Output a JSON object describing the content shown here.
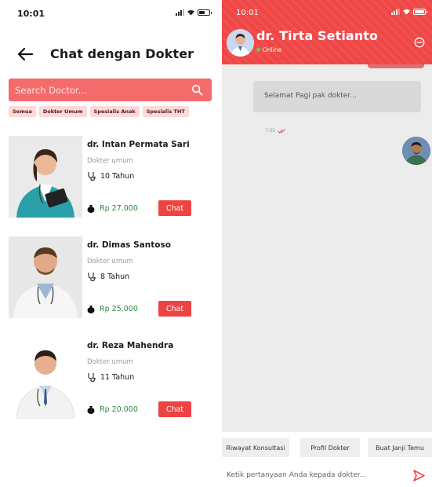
{
  "left": {
    "status": {
      "time": "10:01"
    },
    "title": "Chat dengan Dokter",
    "search": {
      "placeholder": "Search Doctor..."
    },
    "filters": [
      "Semua",
      "Dokter Umum",
      "Spesialis Anak",
      "Spesialis THT"
    ],
    "doctors": [
      {
        "name": "dr. Intan Permata Sari",
        "specialty": "Dokter umum",
        "experience": "10 Tahun",
        "price": "Rp 27.000",
        "chat_label": "Chat"
      },
      {
        "name": "dr. Dimas Santoso",
        "specialty": "Dokter umum",
        "experience": "8 Tahun",
        "price": "Rp 25.000",
        "chat_label": "Chat"
      },
      {
        "name": "dr. Reza Mahendra",
        "specialty": "Dokter umum",
        "experience": "11 Tahun",
        "price": "Rp 20.000",
        "chat_label": "Chat"
      }
    ]
  },
  "right": {
    "status": {
      "time": "10:01"
    },
    "doctor_name": "dr. Tirta Setianto",
    "status_text": "Online",
    "message": {
      "text": "Selamat Pagi pak dokter...",
      "time": "7:01"
    },
    "quick_actions": [
      "Riwayat Konsultasi",
      "Profil Dokter",
      "Buat Janji Temu"
    ],
    "input": {
      "placeholder": "Ketik pertanyaan Anda kepada dokter..."
    }
  },
  "colors": {
    "accent": "#ef4646",
    "search_bg": "#f36b6b",
    "chip_bg": "#ffd9d9",
    "price_green": "#2e8a3a",
    "online_green": "#57d162"
  }
}
